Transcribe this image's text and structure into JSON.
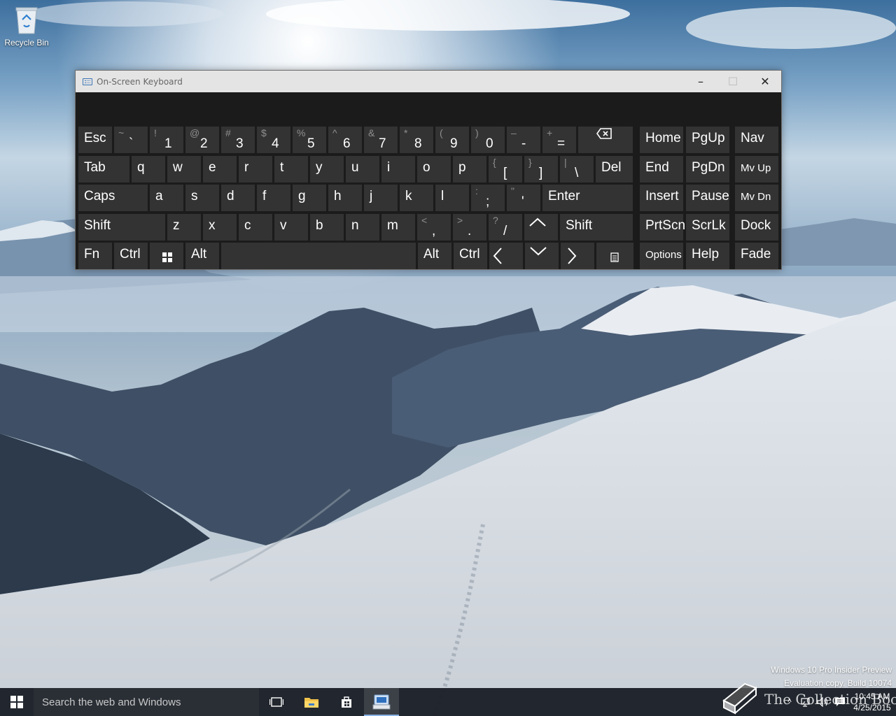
{
  "desktop": {
    "recycle_bin_label": "Recycle Bin"
  },
  "osk": {
    "title": "On-Screen Keyboard",
    "icon": "keyboard-icon",
    "controls": {
      "minimize": "–",
      "maximize": "☐",
      "close": "✕"
    },
    "rows": [
      [
        {
          "id": "esc",
          "label": "Esc",
          "w": 48
        },
        {
          "id": "backquote",
          "shift": "~",
          "base": "`",
          "w": 48
        },
        {
          "id": "1",
          "shift": "!",
          "base": "1",
          "w": 48
        },
        {
          "id": "2",
          "shift": "@",
          "base": "2",
          "w": 48
        },
        {
          "id": "3",
          "shift": "#",
          "base": "3",
          "w": 48
        },
        {
          "id": "4",
          "shift": "$",
          "base": "4",
          "w": 48
        },
        {
          "id": "5",
          "shift": "%",
          "base": "5",
          "w": 48
        },
        {
          "id": "6",
          "shift": "^",
          "base": "6",
          "w": 48
        },
        {
          "id": "7",
          "shift": "&",
          "base": "7",
          "w": 48
        },
        {
          "id": "8",
          "shift": "*",
          "base": "8",
          "w": 48
        },
        {
          "id": "9",
          "shift": "(",
          "base": "9",
          "w": 48
        },
        {
          "id": "0",
          "shift": ")",
          "base": "0",
          "w": 48
        },
        {
          "id": "minus",
          "shift": "–",
          "base": "-",
          "w": 48
        },
        {
          "id": "equals",
          "shift": "+",
          "base": "=",
          "w": 48
        },
        {
          "id": "backspace",
          "icon": "backspace-icon",
          "w": 78
        }
      ],
      [
        {
          "id": "tab",
          "label": "Tab",
          "w": 73
        },
        {
          "id": "q",
          "label": "q",
          "w": 48
        },
        {
          "id": "w",
          "label": "w",
          "w": 48
        },
        {
          "id": "e",
          "label": "e",
          "w": 48
        },
        {
          "id": "r",
          "label": "r",
          "w": 48
        },
        {
          "id": "t",
          "label": "t",
          "w": 48
        },
        {
          "id": "y",
          "label": "y",
          "w": 48
        },
        {
          "id": "u",
          "label": "u",
          "w": 48
        },
        {
          "id": "i",
          "label": "i",
          "w": 48
        },
        {
          "id": "o",
          "label": "o",
          "w": 48
        },
        {
          "id": "p",
          "label": "p",
          "w": 48
        },
        {
          "id": "lbracket",
          "shift": "{",
          "base": "[",
          "w": 48
        },
        {
          "id": "rbracket",
          "shift": "}",
          "base": "]",
          "w": 48
        },
        {
          "id": "backslash",
          "shift": "|",
          "base": "\\",
          "w": 48
        },
        {
          "id": "del",
          "label": "Del",
          "w": 53
        }
      ],
      [
        {
          "id": "caps",
          "label": "Caps",
          "w": 99
        },
        {
          "id": "a",
          "label": "a",
          "w": 48
        },
        {
          "id": "s",
          "label": "s",
          "w": 48
        },
        {
          "id": "d",
          "label": "d",
          "w": 48
        },
        {
          "id": "f",
          "label": "f",
          "w": 48
        },
        {
          "id": "g",
          "label": "g",
          "w": 48
        },
        {
          "id": "h",
          "label": "h",
          "w": 48
        },
        {
          "id": "j",
          "label": "j",
          "w": 48
        },
        {
          "id": "k",
          "label": "k",
          "w": 48
        },
        {
          "id": "l",
          "label": "l",
          "w": 48
        },
        {
          "id": "semicolon",
          "shift": ":",
          "base": ";",
          "w": 48
        },
        {
          "id": "quote",
          "shift": "\"",
          "base": "'",
          "w": 48
        },
        {
          "id": "enter",
          "label": "Enter",
          "w": 129
        }
      ],
      [
        {
          "id": "lshift",
          "label": "Shift",
          "w": 124
        },
        {
          "id": "z",
          "label": "z",
          "w": 48
        },
        {
          "id": "x",
          "label": "x",
          "w": 48
        },
        {
          "id": "c",
          "label": "c",
          "w": 48
        },
        {
          "id": "v",
          "label": "v",
          "w": 48
        },
        {
          "id": "b",
          "label": "b",
          "w": 48
        },
        {
          "id": "n",
          "label": "n",
          "w": 48
        },
        {
          "id": "m",
          "label": "m",
          "w": 48
        },
        {
          "id": "comma",
          "shift": "<",
          "base": ",",
          "w": 48
        },
        {
          "id": "period",
          "shift": ">",
          "base": ".",
          "w": 48
        },
        {
          "id": "slash",
          "shift": "?",
          "base": "/",
          "w": 48
        },
        {
          "id": "up",
          "icon": "arrow-up-icon",
          "w": 48
        },
        {
          "id": "rshift",
          "label": "Shift",
          "w": 104
        }
      ],
      [
        {
          "id": "fn",
          "label": "Fn",
          "w": 48
        },
        {
          "id": "lctrl",
          "label": "Ctrl",
          "w": 48
        },
        {
          "id": "win",
          "icon": "windows-logo-icon",
          "w": 48
        },
        {
          "id": "lalt",
          "label": "Alt",
          "w": 48
        },
        {
          "id": "space",
          "label": "",
          "w": 278
        },
        {
          "id": "ralt",
          "label": "Alt",
          "w": 48
        },
        {
          "id": "rctrl",
          "label": "Ctrl",
          "w": 48
        },
        {
          "id": "left",
          "icon": "arrow-left-icon",
          "w": 48
        },
        {
          "id": "down",
          "icon": "arrow-down-icon",
          "w": 48
        },
        {
          "id": "right",
          "icon": "arrow-right-icon",
          "w": 48
        },
        {
          "id": "menu",
          "icon": "context-menu-icon",
          "w": 53
        }
      ]
    ],
    "nav_rows": [
      [
        {
          "id": "home",
          "label": "Home"
        },
        {
          "id": "pgup",
          "label": "PgUp"
        },
        {
          "id": "nav",
          "label": "Nav"
        }
      ],
      [
        {
          "id": "end",
          "label": "End"
        },
        {
          "id": "pgdn",
          "label": "PgDn"
        },
        {
          "id": "mvup",
          "label": "Mv Up",
          "small": true
        }
      ],
      [
        {
          "id": "insert",
          "label": "Insert"
        },
        {
          "id": "pause",
          "label": "Pause"
        },
        {
          "id": "mvdn",
          "label": "Mv Dn",
          "small": true
        }
      ],
      [
        {
          "id": "prtscn",
          "label": "PrtScn"
        },
        {
          "id": "scrlk",
          "label": "ScrLk"
        },
        {
          "id": "dock",
          "label": "Dock"
        }
      ],
      [
        {
          "id": "options",
          "label": "Options",
          "small": true
        },
        {
          "id": "help",
          "label": "Help"
        },
        {
          "id": "fade",
          "label": "Fade"
        }
      ]
    ]
  },
  "watermark": {
    "line1": "Windows 10 Pro Insider Preview",
    "line2": "Evaluation copy. Build 10074"
  },
  "collection_overlay": "The Collection Book",
  "taskbar": {
    "search_placeholder": "Search the web and Windows",
    "time": "10:45 AM",
    "date": "4/25/2015",
    "tray_chevron": "^"
  },
  "colors": {
    "key_bg": "#333333",
    "window_bg": "#1b1b1b",
    "taskbar_bg": "#181e26",
    "accent": "#8ab4e8"
  }
}
